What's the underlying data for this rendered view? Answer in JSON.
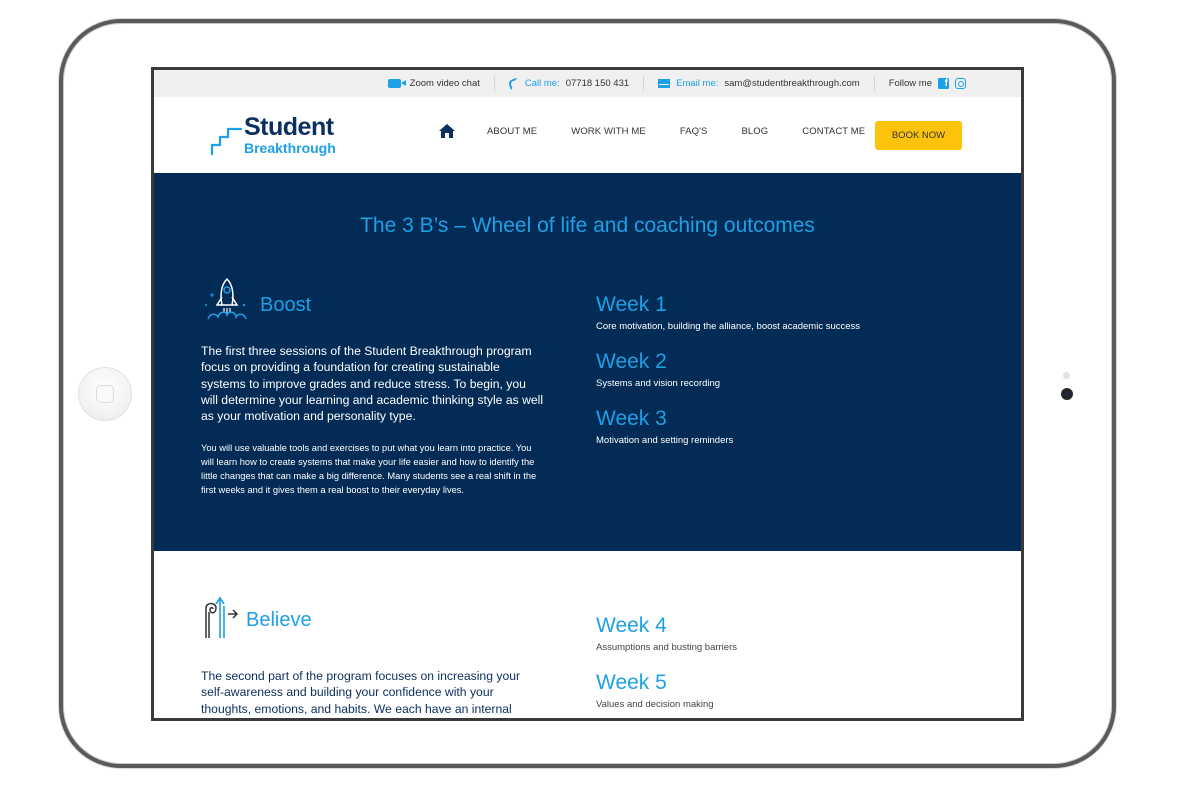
{
  "topbar": {
    "video": {
      "icon": "video-camera-icon",
      "text": "Zoom video chat"
    },
    "phone": {
      "icon": "phone-icon",
      "label": "Call me:",
      "value": "07718 150 431"
    },
    "email": {
      "icon": "mail-icon",
      "label": "Email me:",
      "value": "sam@studentbreakthrough.com"
    },
    "social": {
      "label": "Follow me",
      "facebook": "f",
      "icons": [
        "facebook-icon",
        "instagram-icon"
      ]
    }
  },
  "header": {
    "logo": {
      "line1": "Student",
      "line2": "Breakthrough"
    },
    "nav": [
      {
        "label": "ABOUT ME"
      },
      {
        "label": "WORK WITH ME"
      },
      {
        "label": "FAQ'S"
      },
      {
        "label": "BLOG"
      },
      {
        "label": "CONTACT ME"
      }
    ],
    "cta": "BOOK NOW"
  },
  "colors": {
    "brand_dark": "#022b56",
    "accent": "#1ea0e6",
    "cta": "#fdc20c"
  },
  "dark_section": {
    "title": "The 3 B’s – Wheel of life and coaching outcomes",
    "heading": "Boost",
    "para1": "The first three sessions of the Student Breakthrough program focus on providing a foundation for creating sustainable systems to improve grades and reduce stress. To begin, you will determine your learning and academic thinking style as well as your motivation and personality type.",
    "para2": "You will use valuable tools and exercises to put what you learn into practice. You will learn how to create systems that make your life easier and how to identify the little changes that can make a big difference. Many students see a real shift in the first weeks and it gives them a real boost to their everyday lives.",
    "weeks": [
      {
        "title": "Week 1",
        "desc": "Core motivation, building the alliance, boost academic success"
      },
      {
        "title": "Week 2",
        "desc": "Systems and vision recording"
      },
      {
        "title": "Week 3",
        "desc": "Motivation and setting reminders"
      }
    ]
  },
  "white_section": {
    "heading": "Believe",
    "para1": "The second part of the program focuses on increasing your self-awareness and building your confidence with your thoughts, emotions, and habits. We each have an internal language and dialogue and some of our experiences will add to the belief we carry about",
    "weeks": [
      {
        "title": "Week 4",
        "desc": "Assumptions and busting barriers"
      },
      {
        "title": "Week 5",
        "desc": "Values and decision making"
      }
    ]
  }
}
